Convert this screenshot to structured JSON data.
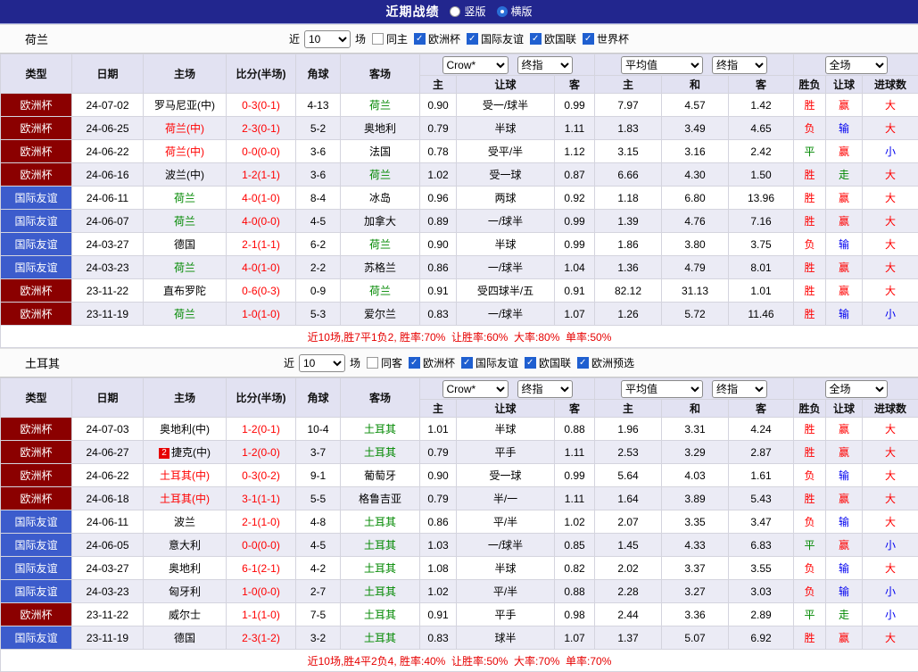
{
  "topbar": {
    "title": "近期战绩",
    "view_options": [
      {
        "label": "竖版",
        "selected": false
      },
      {
        "label": "横版",
        "selected": true
      }
    ]
  },
  "table_header": {
    "cols": [
      "类型",
      "日期",
      "主场",
      "比分(半场)",
      "角球",
      "客场"
    ],
    "odds_dropdowns": [
      "Crow*",
      "终指"
    ],
    "avg_dropdowns": [
      "平均值",
      "终指"
    ],
    "scope_dropdown": "全场",
    "sub": [
      "主",
      "让球",
      "客",
      "主",
      "和",
      "客",
      "胜负",
      "让球",
      "进球数"
    ]
  },
  "colors": {
    "topbar_bg": "#22268e",
    "accent_blue": "#2a6fd6",
    "type": {
      "欧洲杯": "#8b0000",
      "国际友谊": "#3c5ccc"
    },
    "win_red": "#ff0000",
    "draw_green": "#008800",
    "lose_blue": "#0000f0",
    "team_green": "#008800",
    "team_red": "#ff0000",
    "summary_red": "#e60000"
  },
  "sections": [
    {
      "team": "荷兰",
      "filter": {
        "recent": "近",
        "count": "10",
        "unit": "场",
        "venue": {
          "label": "同主",
          "checked": false
        },
        "competitions": [
          {
            "label": "欧洲杯",
            "checked": true
          },
          {
            "label": "国际友谊",
            "checked": true
          },
          {
            "label": "欧国联",
            "checked": true
          },
          {
            "label": "世界杯",
            "checked": true
          }
        ]
      },
      "rows": [
        {
          "type": "欧洲杯",
          "date": "24-07-02",
          "home": "罗马尼亚(中)",
          "home_color": "black",
          "score": "0-3(0-1)",
          "corners": "4-13",
          "away": "荷兰",
          "away_color": "green",
          "odds": [
            "0.90",
            "受一/球半",
            "0.99"
          ],
          "avg": [
            "7.97",
            "4.57",
            "1.42"
          ],
          "res": [
            [
              "胜",
              "red"
            ],
            [
              "赢",
              "red"
            ],
            [
              "大",
              "red"
            ]
          ]
        },
        {
          "type": "欧洲杯",
          "date": "24-06-25",
          "home": "荷兰(中)",
          "home_color": "red",
          "score": "2-3(0-1)",
          "corners": "5-2",
          "away": "奥地利",
          "away_color": "black",
          "odds": [
            "0.79",
            "半球",
            "1.11"
          ],
          "avg": [
            "1.83",
            "3.49",
            "4.65"
          ],
          "res": [
            [
              "负",
              "red"
            ],
            [
              "输",
              "blue"
            ],
            [
              "大",
              "red"
            ]
          ]
        },
        {
          "type": "欧洲杯",
          "date": "24-06-22",
          "home": "荷兰(中)",
          "home_color": "red",
          "score": "0-0(0-0)",
          "corners": "3-6",
          "away": "法国",
          "away_color": "black",
          "odds": [
            "0.78",
            "受平/半",
            "1.12"
          ],
          "avg": [
            "3.15",
            "3.16",
            "2.42"
          ],
          "res": [
            [
              "平",
              "green"
            ],
            [
              "赢",
              "red"
            ],
            [
              "小",
              "blue"
            ]
          ]
        },
        {
          "type": "欧洲杯",
          "date": "24-06-16",
          "home": "波兰(中)",
          "home_color": "black",
          "score": "1-2(1-1)",
          "corners": "3-6",
          "away": "荷兰",
          "away_color": "green",
          "odds": [
            "1.02",
            "受一球",
            "0.87"
          ],
          "avg": [
            "6.66",
            "4.30",
            "1.50"
          ],
          "res": [
            [
              "胜",
              "red"
            ],
            [
              "走",
              "green"
            ],
            [
              "大",
              "red"
            ]
          ]
        },
        {
          "type": "国际友谊",
          "date": "24-06-11",
          "home": "荷兰",
          "home_color": "green",
          "score": "4-0(1-0)",
          "corners": "8-4",
          "away": "冰岛",
          "away_color": "black",
          "odds": [
            "0.96",
            "两球",
            "0.92"
          ],
          "avg": [
            "1.18",
            "6.80",
            "13.96"
          ],
          "res": [
            [
              "胜",
              "red"
            ],
            [
              "赢",
              "red"
            ],
            [
              "大",
              "red"
            ]
          ]
        },
        {
          "type": "国际友谊",
          "date": "24-06-07",
          "home": "荷兰",
          "home_color": "green",
          "score": "4-0(0-0)",
          "corners": "4-5",
          "away": "加拿大",
          "away_color": "black",
          "odds": [
            "0.89",
            "一/球半",
            "0.99"
          ],
          "avg": [
            "1.39",
            "4.76",
            "7.16"
          ],
          "res": [
            [
              "胜",
              "red"
            ],
            [
              "赢",
              "red"
            ],
            [
              "大",
              "red"
            ]
          ]
        },
        {
          "type": "国际友谊",
          "date": "24-03-27",
          "home": "德国",
          "home_color": "black",
          "score": "2-1(1-1)",
          "corners": "6-2",
          "away": "荷兰",
          "away_color": "green",
          "odds": [
            "0.90",
            "半球",
            "0.99"
          ],
          "avg": [
            "1.86",
            "3.80",
            "3.75"
          ],
          "res": [
            [
              "负",
              "red"
            ],
            [
              "输",
              "blue"
            ],
            [
              "大",
              "red"
            ]
          ]
        },
        {
          "type": "国际友谊",
          "date": "24-03-23",
          "home": "荷兰",
          "home_color": "green",
          "score": "4-0(1-0)",
          "corners": "2-2",
          "away": "苏格兰",
          "away_color": "black",
          "odds": [
            "0.86",
            "一/球半",
            "1.04"
          ],
          "avg": [
            "1.36",
            "4.79",
            "8.01"
          ],
          "res": [
            [
              "胜",
              "red"
            ],
            [
              "赢",
              "red"
            ],
            [
              "大",
              "red"
            ]
          ]
        },
        {
          "type": "欧洲杯",
          "date": "23-11-22",
          "home": "直布罗陀",
          "home_color": "black",
          "score": "0-6(0-3)",
          "corners": "0-9",
          "away": "荷兰",
          "away_color": "green",
          "odds": [
            "0.91",
            "受四球半/五",
            "0.91"
          ],
          "avg": [
            "82.12",
            "31.13",
            "1.01"
          ],
          "res": [
            [
              "胜",
              "red"
            ],
            [
              "赢",
              "red"
            ],
            [
              "大",
              "red"
            ]
          ]
        },
        {
          "type": "欧洲杯",
          "date": "23-11-19",
          "home": "荷兰",
          "home_color": "green",
          "score": "1-0(1-0)",
          "corners": "5-3",
          "away": "爱尔兰",
          "away_color": "black",
          "odds": [
            "0.83",
            "一/球半",
            "1.07"
          ],
          "avg": [
            "1.26",
            "5.72",
            "11.46"
          ],
          "res": [
            [
              "胜",
              "red"
            ],
            [
              "输",
              "blue"
            ],
            [
              "小",
              "blue"
            ]
          ]
        }
      ],
      "summary": "近10场,胜7平1负2, 胜率:70%  让胜率:60%  大率:80%  单率:50%"
    },
    {
      "team": "土耳其",
      "filter": {
        "recent": "近",
        "count": "10",
        "unit": "场",
        "venue": {
          "label": "同客",
          "checked": false
        },
        "competitions": [
          {
            "label": "欧洲杯",
            "checked": true
          },
          {
            "label": "国际友谊",
            "checked": true
          },
          {
            "label": "欧国联",
            "checked": true
          },
          {
            "label": "欧洲预选",
            "checked": true
          }
        ]
      },
      "rows": [
        {
          "type": "欧洲杯",
          "date": "24-07-03",
          "home": "奥地利(中)",
          "home_color": "black",
          "score": "1-2(0-1)",
          "corners": "10-4",
          "away": "土耳其",
          "away_color": "green",
          "odds": [
            "1.01",
            "半球",
            "0.88"
          ],
          "avg": [
            "1.96",
            "3.31",
            "4.24"
          ],
          "res": [
            [
              "胜",
              "red"
            ],
            [
              "赢",
              "red"
            ],
            [
              "大",
              "red"
            ]
          ]
        },
        {
          "type": "欧洲杯",
          "date": "24-06-27",
          "home": "捷克(中)",
          "home_color": "black",
          "home_badge": "2",
          "score": "1-2(0-0)",
          "corners": "3-7",
          "away": "土耳其",
          "away_color": "green",
          "odds": [
            "0.79",
            "平手",
            "1.11"
          ],
          "avg": [
            "2.53",
            "3.29",
            "2.87"
          ],
          "res": [
            [
              "胜",
              "red"
            ],
            [
              "赢",
              "red"
            ],
            [
              "大",
              "red"
            ]
          ]
        },
        {
          "type": "欧洲杯",
          "date": "24-06-22",
          "home": "土耳其(中)",
          "home_color": "red",
          "score": "0-3(0-2)",
          "corners": "9-1",
          "away": "葡萄牙",
          "away_color": "black",
          "odds": [
            "0.90",
            "受一球",
            "0.99"
          ],
          "avg": [
            "5.64",
            "4.03",
            "1.61"
          ],
          "res": [
            [
              "负",
              "red"
            ],
            [
              "输",
              "blue"
            ],
            [
              "大",
              "red"
            ]
          ]
        },
        {
          "type": "欧洲杯",
          "date": "24-06-18",
          "home": "土耳其(中)",
          "home_color": "red",
          "score": "3-1(1-1)",
          "corners": "5-5",
          "away": "格鲁吉亚",
          "away_color": "black",
          "odds": [
            "0.79",
            "半/一",
            "1.11"
          ],
          "avg": [
            "1.64",
            "3.89",
            "5.43"
          ],
          "res": [
            [
              "胜",
              "red"
            ],
            [
              "赢",
              "red"
            ],
            [
              "大",
              "red"
            ]
          ]
        },
        {
          "type": "国际友谊",
          "date": "24-06-11",
          "home": "波兰",
          "home_color": "black",
          "score": "2-1(1-0)",
          "corners": "4-8",
          "away": "土耳其",
          "away_color": "green",
          "odds": [
            "0.86",
            "平/半",
            "1.02"
          ],
          "avg": [
            "2.07",
            "3.35",
            "3.47"
          ],
          "res": [
            [
              "负",
              "red"
            ],
            [
              "输",
              "blue"
            ],
            [
              "大",
              "red"
            ]
          ]
        },
        {
          "type": "国际友谊",
          "date": "24-06-05",
          "home": "意大利",
          "home_color": "black",
          "score": "0-0(0-0)",
          "corners": "4-5",
          "away": "土耳其",
          "away_color": "green",
          "odds": [
            "1.03",
            "一/球半",
            "0.85"
          ],
          "avg": [
            "1.45",
            "4.33",
            "6.83"
          ],
          "res": [
            [
              "平",
              "green"
            ],
            [
              "赢",
              "red"
            ],
            [
              "小",
              "blue"
            ]
          ]
        },
        {
          "type": "国际友谊",
          "date": "24-03-27",
          "home": "奥地利",
          "home_color": "black",
          "score": "6-1(2-1)",
          "corners": "4-2",
          "away": "土耳其",
          "away_color": "green",
          "odds": [
            "1.08",
            "半球",
            "0.82"
          ],
          "avg": [
            "2.02",
            "3.37",
            "3.55"
          ],
          "res": [
            [
              "负",
              "red"
            ],
            [
              "输",
              "blue"
            ],
            [
              "大",
              "red"
            ]
          ]
        },
        {
          "type": "国际友谊",
          "date": "24-03-23",
          "home": "匈牙利",
          "home_color": "black",
          "score": "1-0(0-0)",
          "corners": "2-7",
          "away": "土耳其",
          "away_color": "green",
          "odds": [
            "1.02",
            "平/半",
            "0.88"
          ],
          "avg": [
            "2.28",
            "3.27",
            "3.03"
          ],
          "res": [
            [
              "负",
              "red"
            ],
            [
              "输",
              "blue"
            ],
            [
              "小",
              "blue"
            ]
          ]
        },
        {
          "type": "欧洲杯",
          "date": "23-11-22",
          "home": "威尔士",
          "home_color": "black",
          "score": "1-1(1-0)",
          "corners": "7-5",
          "away": "土耳其",
          "away_color": "green",
          "odds": [
            "0.91",
            "平手",
            "0.98"
          ],
          "avg": [
            "2.44",
            "3.36",
            "2.89"
          ],
          "res": [
            [
              "平",
              "green"
            ],
            [
              "走",
              "green"
            ],
            [
              "小",
              "blue"
            ]
          ]
        },
        {
          "type": "国际友谊",
          "date": "23-11-19",
          "home": "德国",
          "home_color": "black",
          "score": "2-3(1-2)",
          "corners": "3-2",
          "away": "土耳其",
          "away_color": "green",
          "odds": [
            "0.83",
            "球半",
            "1.07"
          ],
          "avg": [
            "1.37",
            "5.07",
            "6.92"
          ],
          "res": [
            [
              "胜",
              "red"
            ],
            [
              "赢",
              "red"
            ],
            [
              "大",
              "red"
            ]
          ]
        }
      ],
      "summary": "近10场,胜4平2负4, 胜率:40%  让胜率:50%  大率:70%  单率:70%"
    }
  ]
}
